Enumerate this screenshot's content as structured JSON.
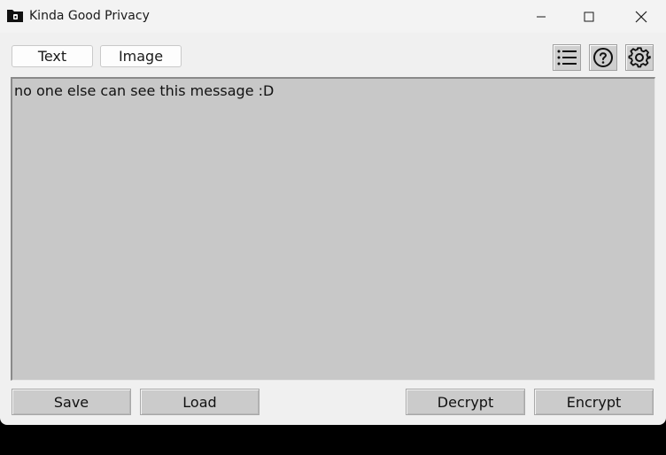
{
  "window": {
    "title": "Kinda Good Privacy"
  },
  "tabs": [
    {
      "label": "Text"
    },
    {
      "label": "Image"
    }
  ],
  "toolbar": {
    "list_icon": "list-icon",
    "help_icon": "help-icon",
    "settings_icon": "gear-icon"
  },
  "editor": {
    "content": "no one else can see this message :D"
  },
  "actions": {
    "save_label": "Save",
    "load_label": "Load",
    "decrypt_label": "Decrypt",
    "encrypt_label": "Encrypt"
  },
  "colors": {
    "window_bg": "#f0f0f0",
    "editor_bg": "#c8c8c8",
    "button_bg": "#cbcbcb"
  }
}
